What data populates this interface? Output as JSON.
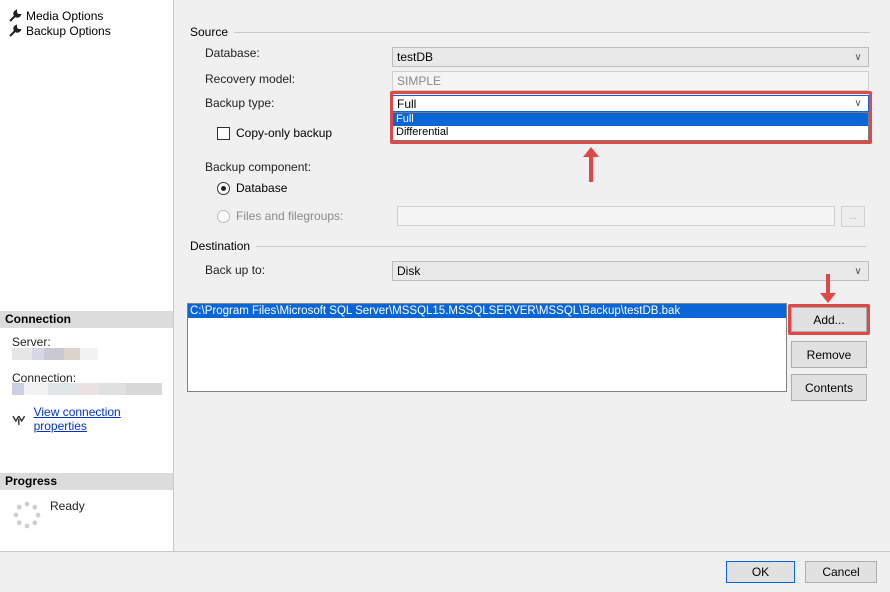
{
  "sidebar": {
    "nav_items": [
      "Media Options",
      "Backup Options"
    ],
    "connection": {
      "header": "Connection",
      "server_label": "Server:",
      "connection_label": "Connection:",
      "link": "View connection properties"
    },
    "progress": {
      "header": "Progress",
      "status": "Ready"
    }
  },
  "source": {
    "title": "Source",
    "database_label": "Database:",
    "database_value": "testDB",
    "recovery_label": "Recovery model:",
    "recovery_value": "SIMPLE",
    "backup_type_label": "Backup type:",
    "backup_type_value": "Full",
    "backup_type_options": [
      "Full",
      "Differential"
    ],
    "copy_only_label": "Copy-only backup",
    "component_label": "Backup component:",
    "component_database": "Database",
    "component_files": "Files and filegroups:",
    "files_browse": "..."
  },
  "destination": {
    "title": "Destination",
    "back_up_to_label": "Back up to:",
    "back_up_to_value": "Disk",
    "paths": [
      "C:\\Program Files\\Microsoft SQL Server\\MSSQL15.MSSQLSERVER\\MSSQL\\Backup\\testDB.bak"
    ],
    "add": "Add...",
    "remove": "Remove",
    "contents": "Contents"
  },
  "footer": {
    "ok": "OK",
    "cancel": "Cancel"
  },
  "colors": {
    "selection": "#0a66d6",
    "annotation": "#e04848",
    "link": "#0033cc"
  }
}
